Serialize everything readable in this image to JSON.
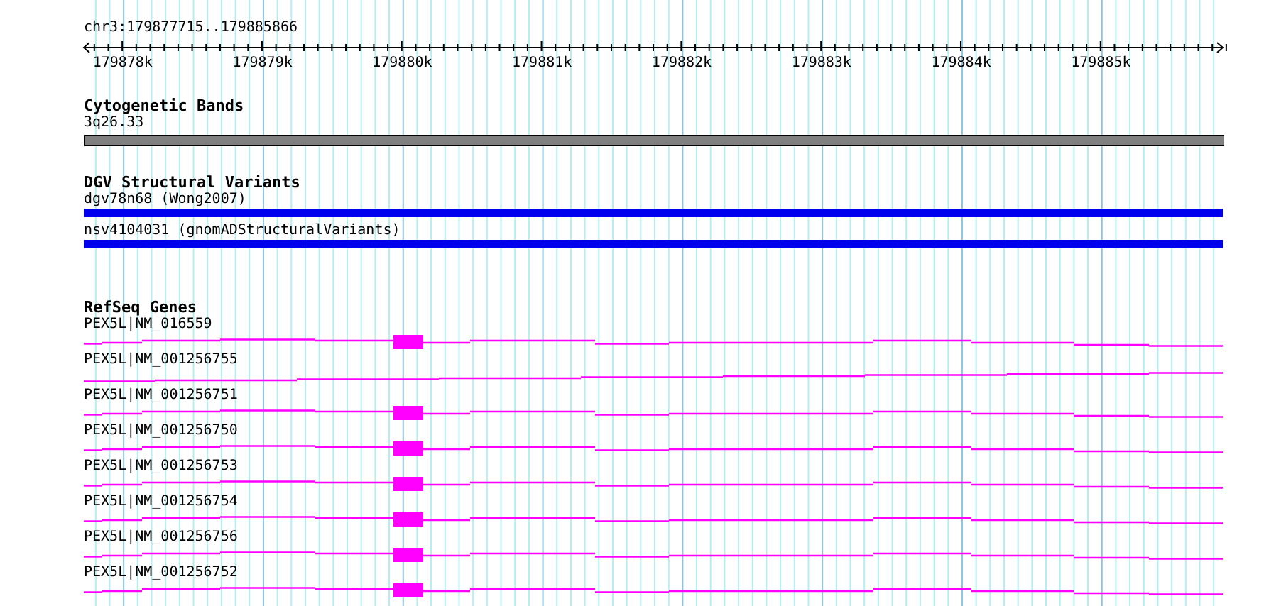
{
  "region": "chr3:179877715..179885866",
  "ruler": {
    "ticks": [
      "179878k",
      "179879k",
      "179880k",
      "179881k",
      "179882k",
      "179883k",
      "179884k",
      "179885k"
    ]
  },
  "tracks": [
    {
      "title": "Cytogenetic Bands",
      "kind": "band",
      "features": [
        {
          "label": "3q26.33"
        }
      ]
    },
    {
      "title": "DGV Structural Variants",
      "kind": "variant",
      "features": [
        {
          "label": "dgv78n68 (Wong2007)"
        },
        {
          "label": "nsv4104031 (gnomADStructuralVariants)"
        }
      ]
    },
    {
      "title": "RefSeq Genes",
      "kind": "gene",
      "features": [
        {
          "label": "PEX5L|NM_016559",
          "exon_shown": true
        },
        {
          "label": "PEX5L|NM_001256755",
          "exon_shown": false
        },
        {
          "label": "PEX5L|NM_001256751",
          "exon_shown": true
        },
        {
          "label": "PEX5L|NM_001256750",
          "exon_shown": true
        },
        {
          "label": "PEX5L|NM_001256753",
          "exon_shown": true
        },
        {
          "label": "PEX5L|NM_001256754",
          "exon_shown": true
        },
        {
          "label": "PEX5L|NM_001256756",
          "exon_shown": true
        },
        {
          "label": "PEX5L|NM_001256752",
          "exon_shown": true
        }
      ]
    }
  ]
}
